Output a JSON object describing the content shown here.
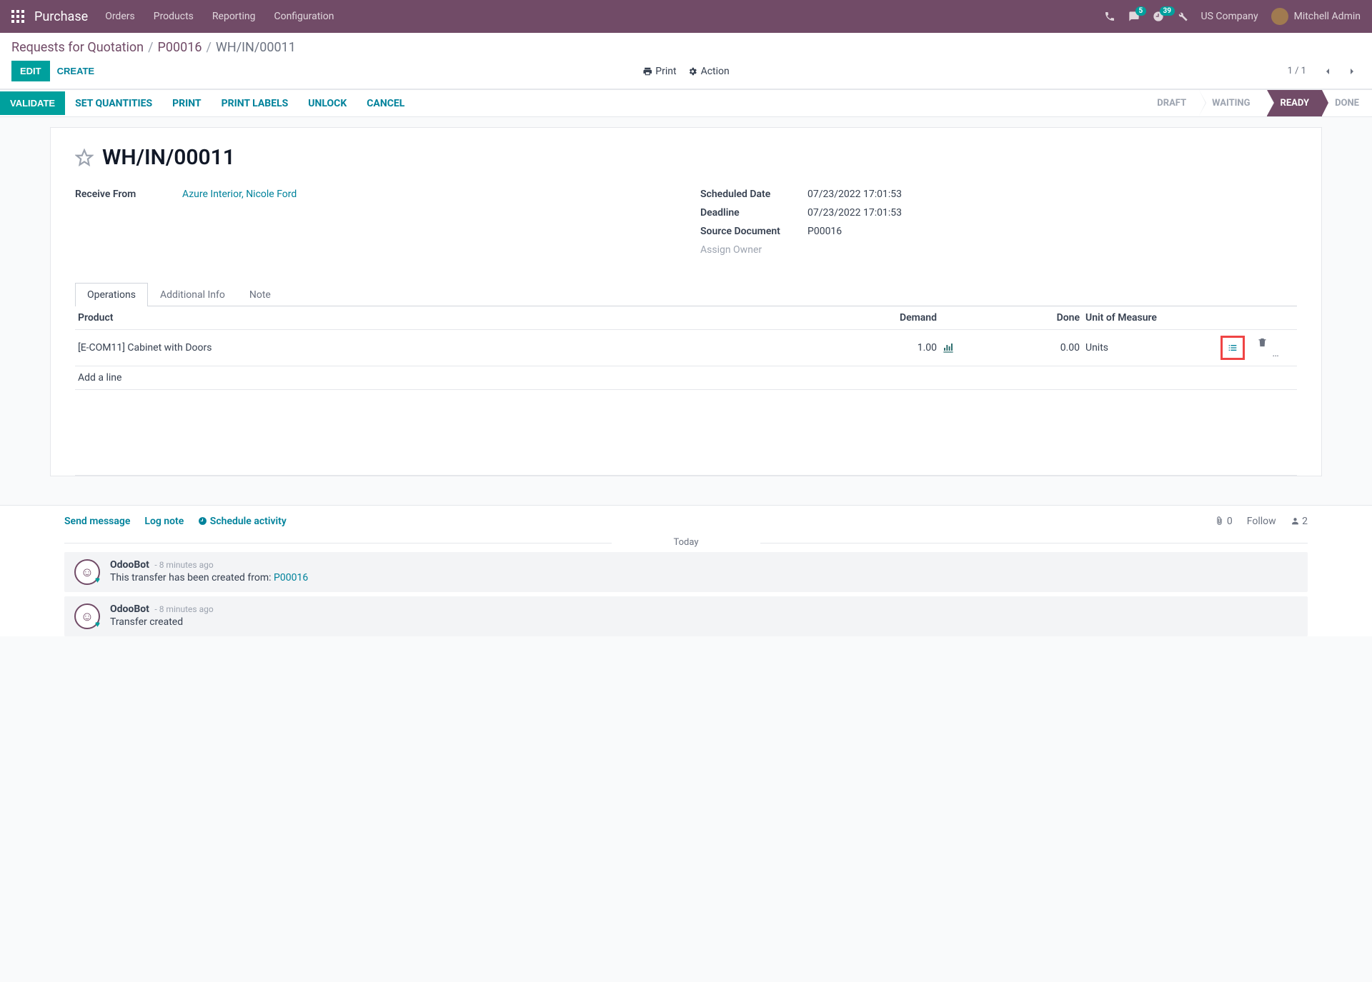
{
  "topbar": {
    "brand": "Purchase",
    "nav": [
      "Orders",
      "Products",
      "Reporting",
      "Configuration"
    ],
    "messages_badge": "5",
    "activities_badge": "39",
    "company": "US Company",
    "user": "Mitchell Admin"
  },
  "breadcrumbs": {
    "crumb1": "Requests for Quotation",
    "crumb2": "P00016",
    "crumb3": "WH/IN/00011"
  },
  "controlbar": {
    "edit": "EDIT",
    "create": "CREATE",
    "print": "Print",
    "action": "Action",
    "pager": "1 / 1"
  },
  "statusbar": {
    "validate": "VALIDATE",
    "set_quantities": "SET QUANTITIES",
    "print": "PRINT",
    "print_labels": "PRINT LABELS",
    "unlock": "UNLOCK",
    "cancel": "CANCEL",
    "stages": [
      "DRAFT",
      "WAITING",
      "READY",
      "DONE"
    ]
  },
  "record": {
    "title": "WH/IN/00011",
    "receive_from_label": "Receive From",
    "receive_from_value": "Azure Interior, Nicole Ford",
    "scheduled_date_label": "Scheduled Date",
    "scheduled_date_value": "07/23/2022 17:01:53",
    "deadline_label": "Deadline",
    "deadline_value": "07/23/2022 17:01:53",
    "source_doc_label": "Source Document",
    "source_doc_value": "P00016",
    "assign_owner_label": "Assign Owner"
  },
  "tabs": {
    "operations": "Operations",
    "additional_info": "Additional Info",
    "note": "Note"
  },
  "table": {
    "headers": {
      "product": "Product",
      "demand": "Demand",
      "done": "Done",
      "uom": "Unit of Measure"
    },
    "rows": [
      {
        "product": "[E-COM11] Cabinet with Doors",
        "demand": "1.00",
        "done": "0.00",
        "uom": "Units"
      }
    ],
    "add_a_line": "Add a line"
  },
  "chatter": {
    "send_message": "Send message",
    "log_note": "Log note",
    "schedule_activity": "Schedule activity",
    "attachments": "0",
    "follow": "Follow",
    "followers": "2",
    "today": "Today",
    "messages": [
      {
        "author": "OdooBot",
        "time": "- 8 minutes ago",
        "text_pre": "This transfer has been created from: ",
        "text_link": "P00016"
      },
      {
        "author": "OdooBot",
        "time": "- 8 minutes ago",
        "text_pre": "Transfer created",
        "text_link": ""
      }
    ]
  }
}
